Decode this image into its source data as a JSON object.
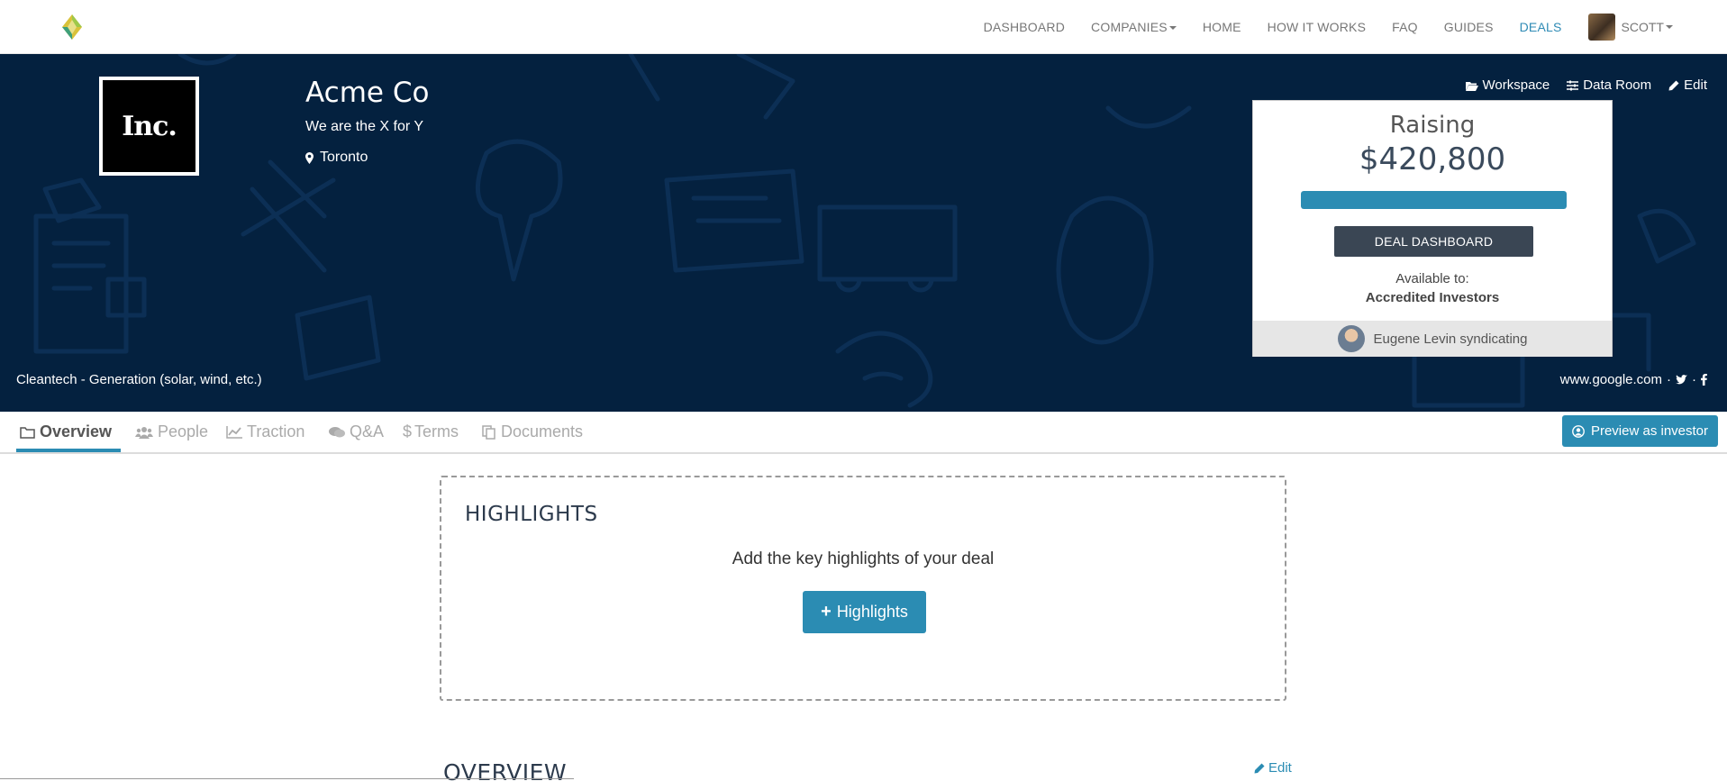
{
  "nav": {
    "items": [
      {
        "label": "DASHBOARD",
        "active": false,
        "dropdown": false
      },
      {
        "label": "COMPANIES",
        "active": false,
        "dropdown": true
      },
      {
        "label": "HOME",
        "active": false,
        "dropdown": false
      },
      {
        "label": "HOW IT WORKS",
        "active": false,
        "dropdown": false
      },
      {
        "label": "FAQ",
        "active": false,
        "dropdown": false
      },
      {
        "label": "GUIDES",
        "active": false,
        "dropdown": false
      },
      {
        "label": "DEALS",
        "active": true,
        "dropdown": false
      }
    ],
    "user": "SCOTT"
  },
  "company": {
    "logo_text": "Inc.",
    "name": "Acme Co",
    "tagline": "We are the X for Y",
    "location": "Toronto",
    "sector": "Cleantech - Generation (solar, wind, etc.)",
    "website": "www.google.com"
  },
  "hero_links": {
    "workspace": "Workspace",
    "data_room": "Data Room",
    "edit": "Edit"
  },
  "raising": {
    "label": "Raising",
    "amount": "$420,800",
    "progress_percent": 100,
    "deal_dashboard": "DEAL DASHBOARD",
    "available_label": "Available to:",
    "available_value": "Accredited Investors",
    "syndicate": "Eugene Levin syndicating"
  },
  "tabs": [
    {
      "label": "Overview",
      "icon": "folder-icon",
      "active": true
    },
    {
      "label": "People",
      "icon": "users-icon",
      "active": false
    },
    {
      "label": "Traction",
      "icon": "line-chart-icon",
      "active": false
    },
    {
      "label": "Q&A",
      "icon": "comments-icon",
      "active": false
    },
    {
      "label": "Terms",
      "icon": "dollar-icon",
      "active": false
    },
    {
      "label": "Documents",
      "icon": "documents-icon",
      "active": false
    }
  ],
  "preview_button": "Preview as investor",
  "highlights": {
    "title": "HIGHLIGHTS",
    "prompt": "Add the key highlights of your deal",
    "button": "Highlights"
  },
  "overview": {
    "title": "OVERVIEW",
    "edit": "Edit"
  },
  "colors": {
    "hero_bg": "#04213f",
    "accent": "#2b8cb3",
    "deal_button": "#3a4654"
  }
}
